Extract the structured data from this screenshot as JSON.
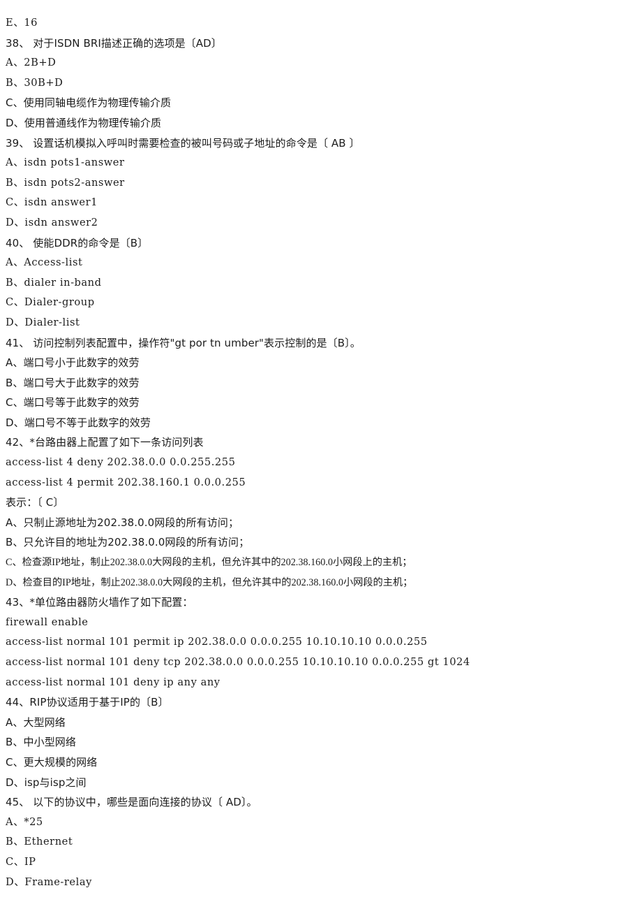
{
  "document": {
    "page_background": "#ffffff",
    "text_color": "#1c1c1c",
    "lines": [
      {
        "id": "l01",
        "text": "E、16",
        "style": "mono"
      },
      {
        "id": "l02",
        "text": "38、 对于ISDN BRI描述正确的选项是〔AD〕",
        "style": "cjk"
      },
      {
        "id": "l03",
        "text": "A、2B+D",
        "style": "mono"
      },
      {
        "id": "l04",
        "text": "B、30B+D",
        "style": "mono"
      },
      {
        "id": "l05",
        "text": "C、使用同轴电缆作为物理传输介质",
        "style": "cjk"
      },
      {
        "id": "l06",
        "text": "D、使用普通线作为物理传输介质",
        "style": "cjk"
      },
      {
        "id": "l07",
        "text": "39、 设置话机模拟入呼叫时需要检查的被叫号码或子地址的命令是〔 AB 〕",
        "style": "cjk"
      },
      {
        "id": "l08",
        "text": "A、isdn pots1-answer",
        "style": "mono"
      },
      {
        "id": "l09",
        "text": "B、isdn pots2-answer",
        "style": "mono"
      },
      {
        "id": "l10",
        "text": "C、isdn answer1",
        "style": "mono"
      },
      {
        "id": "l11",
        "text": "D、isdn answer2",
        "style": "mono"
      },
      {
        "id": "l12",
        "text": "40、 使能DDR的命令是〔B〕",
        "style": "cjk"
      },
      {
        "id": "l13",
        "text": "A、Access-list",
        "style": "mono"
      },
      {
        "id": "l14",
        "text": "B、dialer in-band",
        "style": "mono"
      },
      {
        "id": "l15",
        "text": "C、Dialer-group",
        "style": "mono"
      },
      {
        "id": "l16",
        "text": "D、Dialer-list",
        "style": "mono"
      },
      {
        "id": "l17",
        "text": "41、 访问控制列表配置中，操作符\"gt por tn umber\"表示控制的是〔B〕。",
        "style": "cjk"
      },
      {
        "id": "l18",
        "text": "A、端口号小于此数字的效劳",
        "style": "cjk"
      },
      {
        "id": "l19",
        "text": "B、端口号大于此数字的效劳",
        "style": "cjk"
      },
      {
        "id": "l20",
        "text": "C、端口号等于此数字的效劳",
        "style": "cjk"
      },
      {
        "id": "l21",
        "text": "D、端口号不等于此数字的效劳",
        "style": "cjk"
      },
      {
        "id": "l22",
        "text": "42、*台路由器上配置了如下一条访问列表",
        "style": "cjk"
      },
      {
        "id": "l23",
        "text": "access-list 4 deny 202.38.0.0 0.0.255.255",
        "style": "mono"
      },
      {
        "id": "l24",
        "text": "access-list 4 permit 202.38.160.1 0.0.0.255",
        "style": "mono"
      },
      {
        "id": "l25",
        "text": "表示：〔 C〕",
        "style": "cjk"
      },
      {
        "id": "l26",
        "text": "A、只制止源地址为202.38.0.0网段的所有访问；",
        "style": "cjk"
      },
      {
        "id": "l27",
        "text": "B、只允许目的地址为202.38.0.0网段的所有访问；",
        "style": "cjk"
      },
      {
        "id": "l28",
        "text": "C、检查源IP地址，制止202.38.0.0大网段的主机，但允许其中的202.38.160.0小网段上的主机；",
        "style": "dense"
      },
      {
        "id": "l29",
        "text": "D、检查目的IP地址，制止202.38.0.0大网段的主机，但允许其中的202.38.160.0小网段的主机；",
        "style": "dense"
      },
      {
        "id": "l30",
        "text": "43、*单位路由器防火墙作了如下配置：",
        "style": "cjk"
      },
      {
        "id": "l31",
        "text": "firewall enable",
        "style": "mono"
      },
      {
        "id": "l32",
        "text": "access-list normal 101 permit ip 202.38.0.0 0.0.0.255 10.10.10.10 0.0.0.255",
        "style": "mono"
      },
      {
        "id": "l33",
        "text": "access-list normal 101 deny tcp 202.38.0.0 0.0.0.255 10.10.10.10 0.0.0.255 gt 1024",
        "style": "mono"
      },
      {
        "id": "l34",
        "text": "access-list normal 101 deny ip any any",
        "style": "mono"
      },
      {
        "id": "l35",
        "text": "44、RIP协议适用于基于IP的〔B〕",
        "style": "cjk"
      },
      {
        "id": "l36",
        "text": "A、大型网络",
        "style": "cjk"
      },
      {
        "id": "l37",
        "text": "B、中小型网络",
        "style": "cjk"
      },
      {
        "id": "l38",
        "text": "C、更大规模的网络",
        "style": "cjk"
      },
      {
        "id": "l39",
        "text": "D、isp与isp之间",
        "style": "cjk"
      },
      {
        "id": "l40",
        "text": "45、 以下的协议中，哪些是面向连接的协议〔 AD〕。",
        "style": "cjk"
      },
      {
        "id": "l41",
        "text": "A、*25",
        "style": "mono"
      },
      {
        "id": "l42",
        "text": "B、Ethernet",
        "style": "mono"
      },
      {
        "id": "l43",
        "text": "C、IP",
        "style": "mono"
      },
      {
        "id": "l44",
        "text": "D、Frame-relay",
        "style": "mono"
      }
    ]
  }
}
